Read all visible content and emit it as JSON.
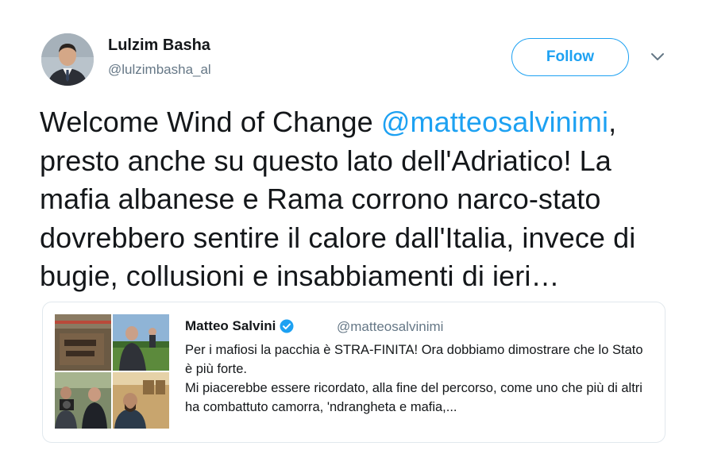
{
  "author": {
    "name": "Lulzim Basha",
    "handle": "@lulzimbasha_al",
    "avatar_icon": "profile-photo"
  },
  "follow_button": {
    "label": "Follow"
  },
  "menu": {
    "icon": "chevron-down-icon"
  },
  "tweet": {
    "text_before": "Welcome Wind of Change ",
    "mention": "@matteosalvinimi",
    "text_after": ", presto anche su questo lato dell'Adriatico! La mafia albanese e Rama corrono narco-stato dovrebbero sentire il calore dall'Italia, invece di bugie, collusioni e insabbiamenti di ieri…"
  },
  "quoted_tweet": {
    "name": "Matteo Salvini",
    "handle": "@matteosalvinimi",
    "verified": true,
    "line1": "Per i mafiosi la pacchia è STRA-FINITA! Ora dobbiamo dimostrare che lo Stato è più forte.",
    "line2": "Mi piacerebbe essere ricordato, alla fine del percorso, come uno che più di altri ha combattuto camorra, 'ndrangheta e mafia,..."
  },
  "colors": {
    "accent": "#1da1f2",
    "text": "#14171a",
    "secondary": "#657786",
    "border": "#e1e8ed"
  }
}
